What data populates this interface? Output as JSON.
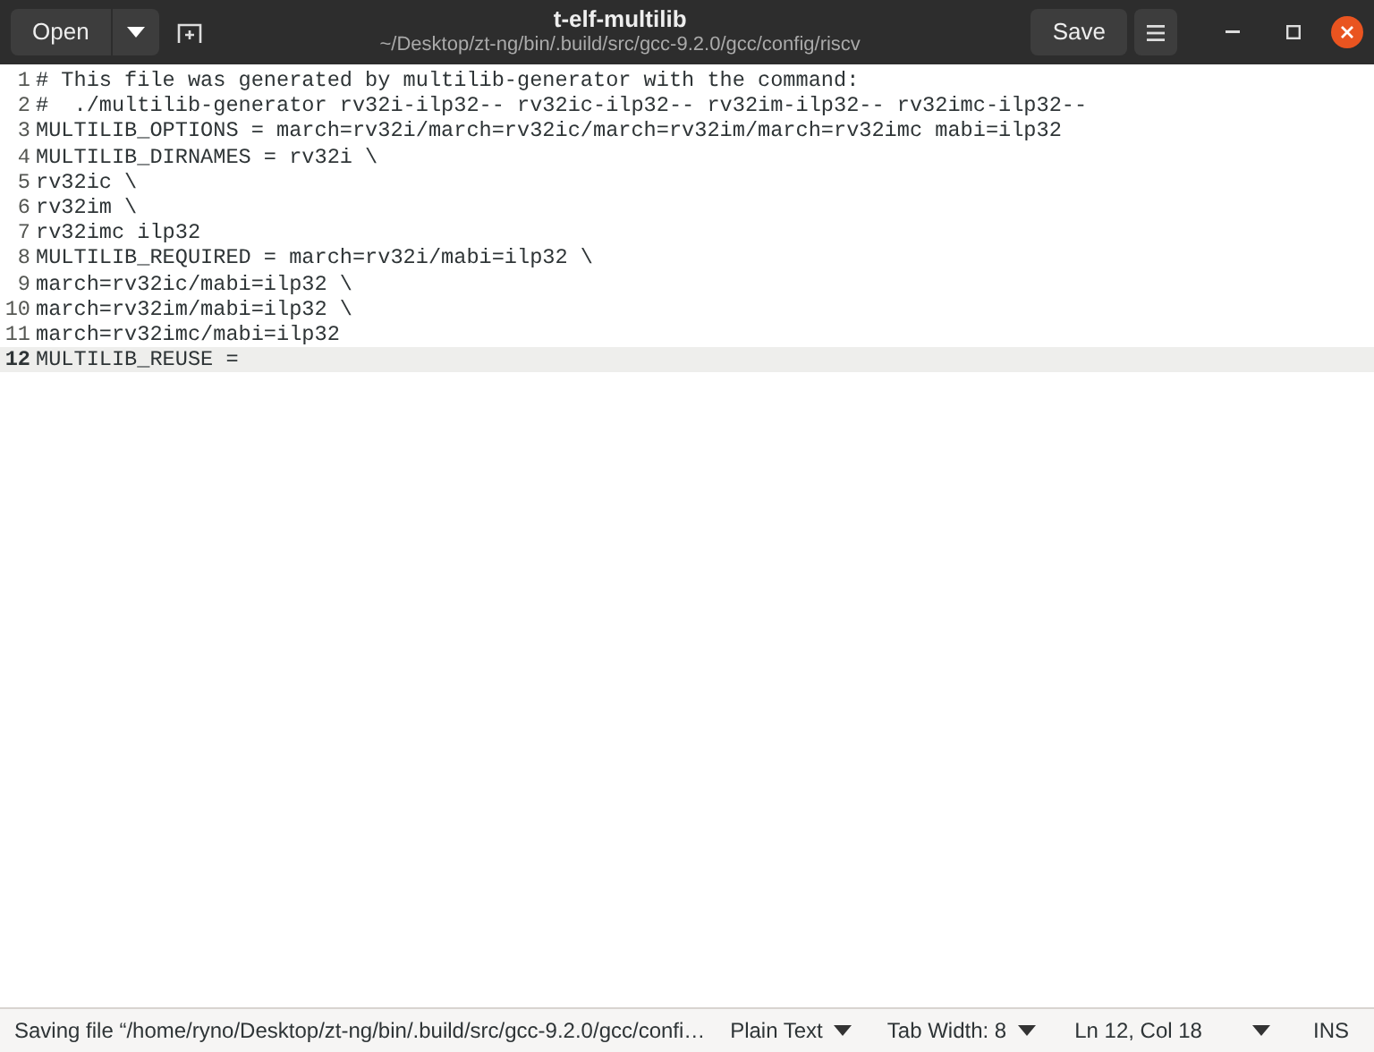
{
  "header": {
    "open_button": "Open",
    "title": "t-elf-multilib",
    "subtitle": "~/Desktop/zt-ng/bin/.build/src/gcc-9.2.0/gcc/config/riscv",
    "save_button": "Save"
  },
  "editor": {
    "lines": [
      {
        "number": "1",
        "text": "# This file was generated by multilib-generator with the command:",
        "current": false
      },
      {
        "number": "2",
        "text": "#  ./multilib-generator rv32i-ilp32-- rv32ic-ilp32-- rv32im-ilp32-- rv32imc-ilp32--",
        "current": false
      },
      {
        "number": "3",
        "text": "MULTILIB_OPTIONS = march=rv32i/march=rv32ic/march=rv32im/march=rv32imc mabi=ilp32",
        "current": false
      },
      {
        "number": "4",
        "text": "MULTILIB_DIRNAMES = rv32i \\",
        "current": false
      },
      {
        "number": "5",
        "text": "rv32ic \\",
        "current": false
      },
      {
        "number": "6",
        "text": "rv32im \\",
        "current": false
      },
      {
        "number": "7",
        "text": "rv32imc ilp32",
        "current": false
      },
      {
        "number": "8",
        "text": "MULTILIB_REQUIRED = march=rv32i/mabi=ilp32 \\",
        "current": false
      },
      {
        "number": "9",
        "text": "march=rv32ic/mabi=ilp32 \\",
        "current": false
      },
      {
        "number": "10",
        "text": "march=rv32im/mabi=ilp32 \\",
        "current": false
      },
      {
        "number": "11",
        "text": "march=rv32imc/mabi=ilp32",
        "current": false
      },
      {
        "number": "12",
        "text": "MULTILIB_REUSE =",
        "current": true
      }
    ]
  },
  "status_bar": {
    "message": "Saving file “/home/ryno/Desktop/zt-ng/bin/.build/src/gcc-9.2.0/gcc/confi…",
    "language": "Plain Text",
    "tab_width": "Tab Width: 8",
    "position": "Ln 12, Col 18",
    "mode": "INS"
  }
}
